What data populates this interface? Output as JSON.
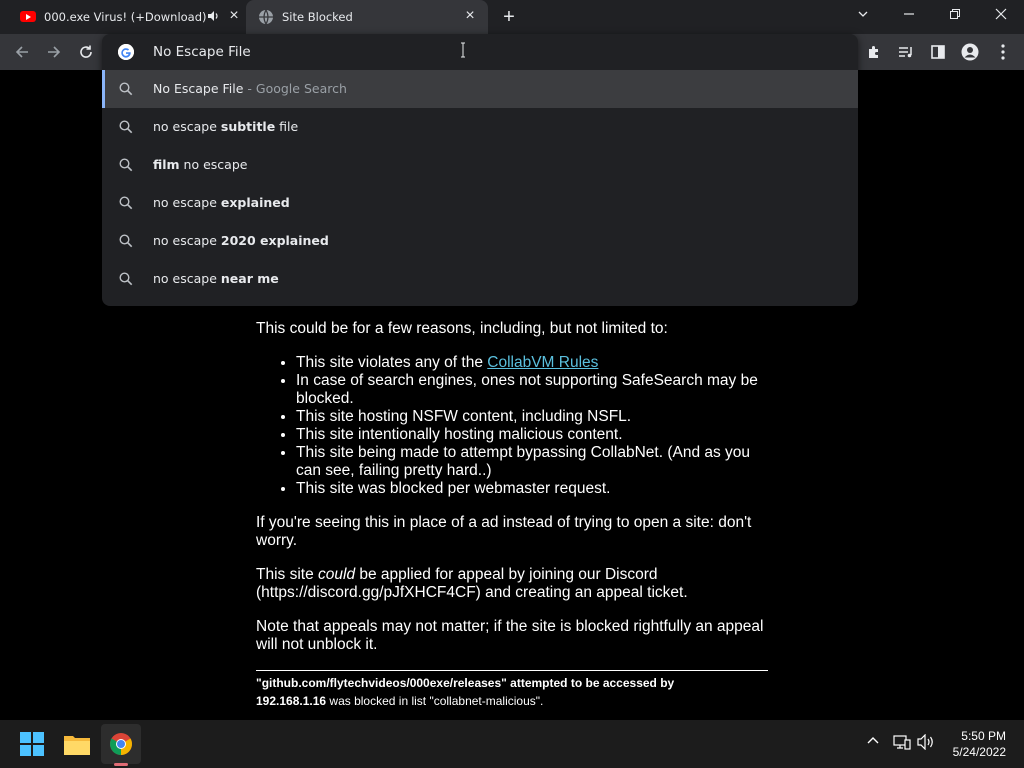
{
  "tabs": [
    {
      "title": "000.exe Virus! (+Download)",
      "favicon": "youtube-icon",
      "audio": true
    },
    {
      "title": "Site Blocked",
      "favicon": "globe-icon",
      "active": true
    }
  ],
  "omnibox": {
    "value": "No Escape File",
    "suggestions": [
      {
        "parts": [
          [
            "No Escape File",
            "n"
          ],
          [
            " - Google Search",
            "d"
          ]
        ]
      },
      {
        "parts": [
          [
            "no escape ",
            "n"
          ],
          [
            "subtitle",
            "b"
          ],
          [
            " file",
            "n"
          ]
        ]
      },
      {
        "parts": [
          [
            "film",
            "b"
          ],
          [
            " no escape",
            "n"
          ]
        ]
      },
      {
        "parts": [
          [
            "no escape ",
            "n"
          ],
          [
            "explained",
            "b"
          ]
        ]
      },
      {
        "parts": [
          [
            "no escape ",
            "n"
          ],
          [
            "2020 explained",
            "b"
          ]
        ]
      },
      {
        "parts": [
          [
            "no escape ",
            "n"
          ],
          [
            "near me",
            "b"
          ]
        ]
      }
    ]
  },
  "page": {
    "intro": "This could be for a few reasons, including, but not limited to:",
    "reason1_prefix": "This site violates any of the ",
    "reason1_link": "CollabVM Rules",
    "reason2": "In case of search engines, ones not supporting SafeSearch may be blocked.",
    "reason3": "This site hosting NSFW content, including NSFL.",
    "reason4": "This site intentionally hosting malicious content.",
    "reason5": "This site being made to attempt bypassing CollabNet. (And as you can see, failing pretty hard..)",
    "reason6": "This site was blocked per webmaster request.",
    "ad_note": "If you're seeing this in place of a ad instead of trying to open a site: don't worry.",
    "appeal_a": "This site ",
    "appeal_em": "could",
    "appeal_b": " be applied for appeal by joining our Discord (https://discord.gg/pJfXHCF4CF) and creating an appeal ticket.",
    "appeal_note": "Note that appeals may not matter; if the site is blocked rightfully an appeal will not unblock it.",
    "footer_url": "\"github.com/flytechvideos/000exe/releases\" attempted to be accessed by",
    "footer_ip": "192.168.1.16",
    "footer_tail": " was blocked in list \"collabnet-malicious\"."
  },
  "taskbar": {
    "time": "5:50 PM",
    "date": "5/24/2022",
    "apps": [
      "start-icon",
      "file-explorer-icon",
      "chrome-icon"
    ]
  },
  "colors": {
    "tabstrip": "#202124",
    "toolbar": "#35363a",
    "link": "#5bc0de",
    "taskbar": "#1c1c1c"
  }
}
